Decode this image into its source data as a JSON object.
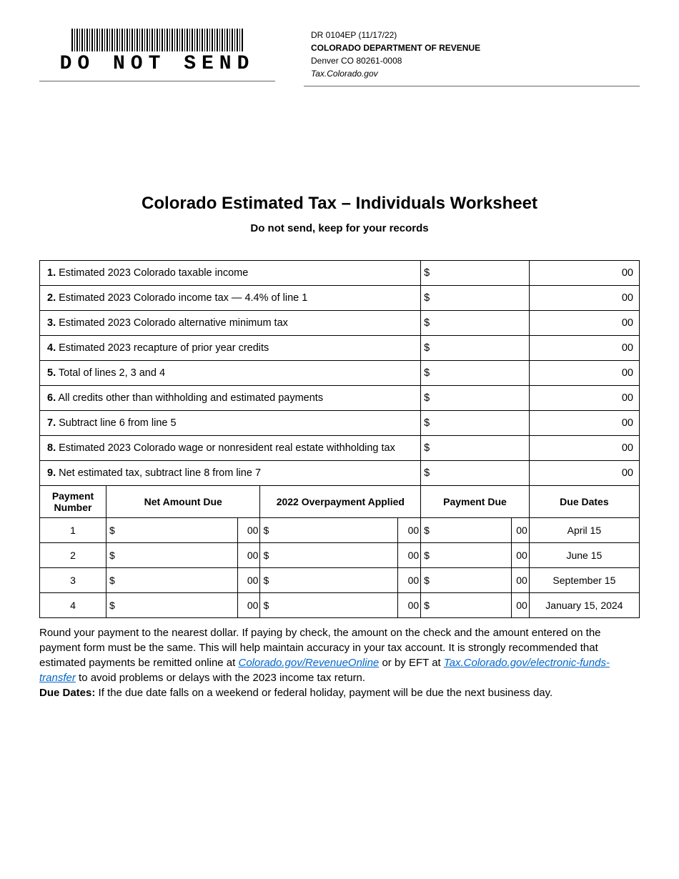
{
  "header": {
    "do_not_send": "DO NOT SEND",
    "form_id": "DR 0104EP (11/17/22)",
    "dept_name": "COLORADO DEPARTMENT OF REVENUE",
    "addr": "Denver CO 80261-0008",
    "site": "Tax.Colorado.gov"
  },
  "title": "Colorado Estimated Tax – Individuals Worksheet",
  "subtitle": "Do not send, keep for your records",
  "lines": [
    {
      "num": "1.",
      "label": "Estimated 2023 Colorado taxable income",
      "dollar": "$",
      "cents": "00"
    },
    {
      "num": "2.",
      "label": "Estimated 2023 Colorado income tax — 4.4% of line 1",
      "dollar": "$",
      "cents": "00"
    },
    {
      "num": "3.",
      "label": "Estimated 2023 Colorado alternative minimum tax",
      "dollar": "$",
      "cents": "00"
    },
    {
      "num": "4.",
      "label": "Estimated 2023 recapture of prior year credits",
      "dollar": "$",
      "cents": "00"
    },
    {
      "num": "5.",
      "label": "Total of lines 2, 3 and 4",
      "dollar": "$",
      "cents": "00"
    },
    {
      "num": "6.",
      "label": "All credits other than withholding and estimated payments",
      "dollar": "$",
      "cents": "00"
    },
    {
      "num": "7.",
      "label": "Subtract line 6 from line 5",
      "dollar": "$",
      "cents": "00"
    },
    {
      "num": "8.",
      "label": "Estimated 2023 Colorado wage or nonresident real estate withholding tax",
      "dollar": "$",
      "cents": "00"
    },
    {
      "num": "9.",
      "label": "Net estimated tax, subtract line 8 from line 7",
      "dollar": "$",
      "cents": "00"
    }
  ],
  "payment_headers": {
    "col1": "Payment Number",
    "col2": "Net Amount Due",
    "col3": "2022 Overpayment Applied",
    "col4": "Payment Due",
    "col5": "Due Dates"
  },
  "payments": [
    {
      "num": "1",
      "net": "$",
      "net_c": "00",
      "over": "$",
      "over_c": "00",
      "due": "$",
      "due_c": "00",
      "date": "April 15"
    },
    {
      "num": "2",
      "net": "$",
      "net_c": "00",
      "over": "$",
      "over_c": "00",
      "due": "$",
      "due_c": "00",
      "date": "June 15"
    },
    {
      "num": "3",
      "net": "$",
      "net_c": "00",
      "over": "$",
      "over_c": "00",
      "due": "$",
      "due_c": "00",
      "date": "September 15"
    },
    {
      "num": "4",
      "net": "$",
      "net_c": "00",
      "over": "$",
      "over_c": "00",
      "due": "$",
      "due_c": "00",
      "date": "January 15, 2024"
    }
  ],
  "notes": {
    "p1a": "Round your payment to the nearest dollar. If paying by check, the amount on the check and the amount entered on the payment form must be the same. This will help maintain accuracy in your tax account. It is strongly recommended that estimated payments be remitted online at ",
    "link1": "Colorado.gov/RevenueOnline",
    "p1b": " or by EFT at ",
    "link2": "Tax.Colorado.gov/electronic-funds-transfer",
    "p1c": " to avoid problems or delays with the 2023 income tax return.",
    "p2_label": "Due Dates:",
    "p2_text": " If the due date falls on a weekend or federal holiday, payment will be due the next business day."
  }
}
